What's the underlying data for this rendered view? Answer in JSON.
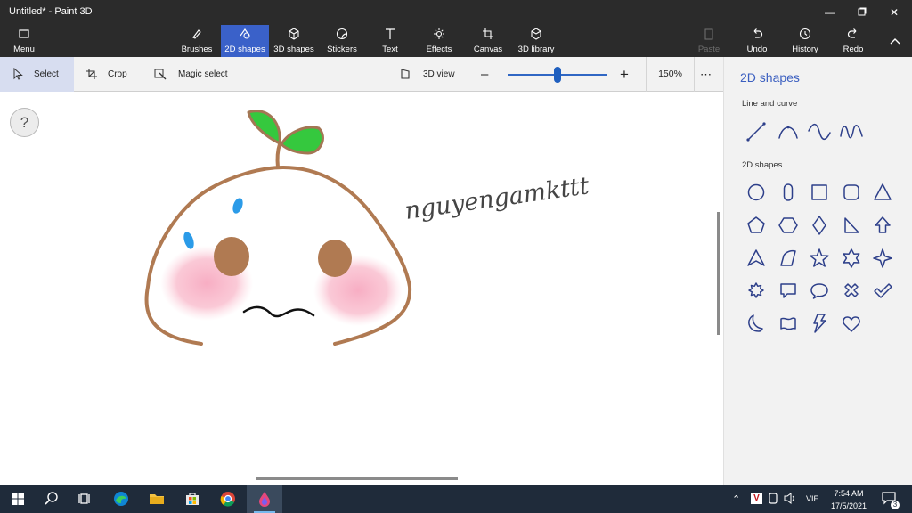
{
  "window": {
    "title": "Untitled* - Paint 3D"
  },
  "ribbon": {
    "menu": "Menu",
    "tools": [
      {
        "label": "Brushes"
      },
      {
        "label": "2D shapes"
      },
      {
        "label": "3D shapes"
      },
      {
        "label": "Stickers"
      },
      {
        "label": "Text"
      },
      {
        "label": "Effects"
      },
      {
        "label": "Canvas"
      },
      {
        "label": "3D library"
      }
    ],
    "paste": "Paste",
    "undo": "Undo",
    "history": "History",
    "redo": "Redo"
  },
  "toolbar": {
    "select": "Select",
    "crop": "Crop",
    "magic_select": "Magic select",
    "view_3d": "3D view",
    "zoom": "150%",
    "zoom_fraction": 0.5
  },
  "canvas": {
    "help": "?",
    "signature": "nguyengamkttt"
  },
  "panel": {
    "title": "2D shapes",
    "line_section": "Line and curve",
    "shapes_section": "2D shapes",
    "line_icons": [
      "line-icon",
      "curve-icon",
      "s-curve-icon",
      "wave-curve-icon"
    ],
    "shape_icons": [
      "circle-icon",
      "rounded-pill-icon",
      "square-icon",
      "rounded-square-icon",
      "triangle-icon",
      "pentagon-icon",
      "hexagon-icon",
      "diamond-icon",
      "right-triangle-icon",
      "arrow-up-icon",
      "open-triangle-icon",
      "quarter-shape-icon",
      "star-5-icon",
      "star-6-icon",
      "star-4-icon",
      "burst-icon",
      "speech-rectangle-icon",
      "speech-oval-icon",
      "cross-icon",
      "check-icon",
      "moon-icon",
      "banner-icon",
      "lightning-icon",
      "heart-icon"
    ]
  },
  "taskbar": {
    "time": "7:54 AM",
    "date": "17/5/2021",
    "language": "VIE",
    "notification_count": "3"
  },
  "colors": {
    "accent": "#3a61c9",
    "title_bar": "#2b2b2b",
    "taskbar": "#1f2b3a"
  }
}
